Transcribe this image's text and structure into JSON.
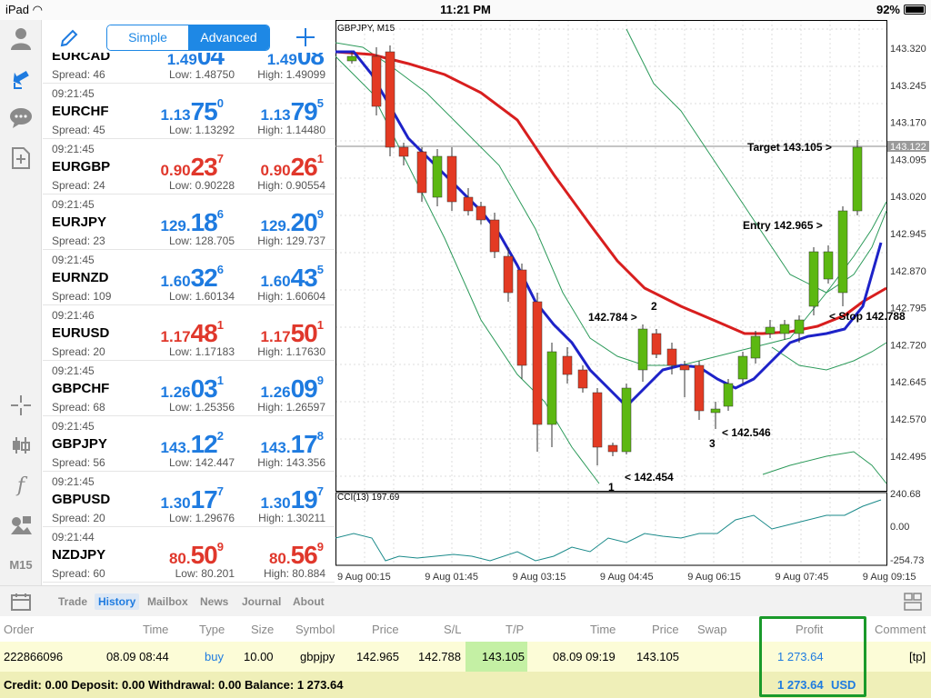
{
  "status": {
    "device": "iPad",
    "time": "11:21 PM",
    "battery": "92%"
  },
  "quotes_header": {
    "simple": "Simple",
    "advanced": "Advanced"
  },
  "toolbar": {
    "timeframe": "M15"
  },
  "quotes": [
    {
      "time": "",
      "symbol": "EURCAD",
      "spread": "Spread: 46",
      "low": "Low: 1.48750",
      "high": "High: 1.49099",
      "bid": {
        "a": "1.49",
        "b": "04",
        "c": ""
      },
      "ask": {
        "a": "1.49",
        "b": "08",
        "c": ""
      },
      "color": "blue"
    },
    {
      "time": "09:21:45",
      "symbol": "EURCHF",
      "spread": "Spread: 45",
      "low": "Low: 1.13292",
      "high": "High: 1.14480",
      "bid": {
        "a": "1.13",
        "b": "75",
        "c": "0"
      },
      "ask": {
        "a": "1.13",
        "b": "79",
        "c": "5"
      },
      "color": "blue"
    },
    {
      "time": "09:21:45",
      "symbol": "EURGBP",
      "spread": "Spread: 24",
      "low": "Low: 0.90228",
      "high": "High: 0.90554",
      "bid": {
        "a": "0.90",
        "b": "23",
        "c": "7"
      },
      "ask": {
        "a": "0.90",
        "b": "26",
        "c": "1"
      },
      "color": "red"
    },
    {
      "time": "09:21:45",
      "symbol": "EURJPY",
      "spread": "Spread: 23",
      "low": "Low: 128.705",
      "high": "High: 129.737",
      "bid": {
        "a": "129.",
        "b": "18",
        "c": "6"
      },
      "ask": {
        "a": "129.",
        "b": "20",
        "c": "9"
      },
      "color": "blue"
    },
    {
      "time": "09:21:45",
      "symbol": "EURNZD",
      "spread": "Spread: 109",
      "low": "Low: 1.60134",
      "high": "High: 1.60604",
      "bid": {
        "a": "1.60",
        "b": "32",
        "c": "6"
      },
      "ask": {
        "a": "1.60",
        "b": "43",
        "c": "5"
      },
      "color": "blue"
    },
    {
      "time": "09:21:46",
      "symbol": "EURUSD",
      "spread": "Spread: 20",
      "low": "Low: 1.17183",
      "high": "High: 1.17630",
      "bid": {
        "a": "1.17",
        "b": "48",
        "c": "1"
      },
      "ask": {
        "a": "1.17",
        "b": "50",
        "c": "1"
      },
      "color": "red"
    },
    {
      "time": "09:21:45",
      "symbol": "GBPCHF",
      "spread": "Spread: 68",
      "low": "Low: 1.25356",
      "high": "High: 1.26597",
      "bid": {
        "a": "1.26",
        "b": "03",
        "c": "1"
      },
      "ask": {
        "a": "1.26",
        "b": "09",
        "c": "9"
      },
      "color": "blue"
    },
    {
      "time": "09:21:45",
      "symbol": "GBPJPY",
      "spread": "Spread: 56",
      "low": "Low: 142.447",
      "high": "High: 143.356",
      "bid": {
        "a": "143.",
        "b": "12",
        "c": "2"
      },
      "ask": {
        "a": "143.",
        "b": "17",
        "c": "8"
      },
      "color": "blue"
    },
    {
      "time": "09:21:45",
      "symbol": "GBPUSD",
      "spread": "Spread: 20",
      "low": "Low: 1.29676",
      "high": "High: 1.30211",
      "bid": {
        "a": "1.30",
        "b": "17",
        "c": "7"
      },
      "ask": {
        "a": "1.30",
        "b": "19",
        "c": "7"
      },
      "color": "blue"
    },
    {
      "time": "09:21:44",
      "symbol": "NZDJPY",
      "spread": "Spread: 60",
      "low": "Low: 80.201",
      "high": "High: 80.884",
      "bid": {
        "a": "80.",
        "b": "50",
        "c": "9"
      },
      "ask": {
        "a": "80.",
        "b": "56",
        "c": "9"
      },
      "color": "red"
    }
  ],
  "chart": {
    "title": "GBPJPY, M15",
    "current_price": "143.122",
    "cci_label": "CCI(13) 197.69",
    "price_ticks": [
      "143.320",
      "143.245",
      "143.170",
      "143.095",
      "143.020",
      "142.945",
      "142.870",
      "142.795",
      "142.720",
      "142.645",
      "142.570",
      "142.495"
    ],
    "cci_ticks": [
      "240.68",
      "0.00",
      "-254.73"
    ],
    "time_ticks": [
      "9 Aug 00:15",
      "9 Aug 01:45",
      "9 Aug 03:15",
      "9 Aug 04:45",
      "9 Aug 06:15",
      "9 Aug 07:45",
      "9 Aug 09:15"
    ],
    "annotations": {
      "target": "Target 143.105 >",
      "entry": "Entry 142.965 >",
      "stop": "< Stop 142.788",
      "p2": "142.784 >",
      "p2n": "2",
      "p1": "< 142.454",
      "p1n": "1",
      "p3": "< 142.546",
      "p3n": "3"
    }
  },
  "tabs": [
    "Trade",
    "History",
    "Mailbox",
    "News",
    "Journal",
    "About"
  ],
  "active_tab": "History",
  "history": {
    "headers": [
      "Order",
      "Time",
      "Type",
      "Size",
      "Symbol",
      "Price",
      "S/L",
      "T/P",
      "Time",
      "Price",
      "Swap",
      "Profit",
      "Comment"
    ],
    "row": {
      "order": "222866096",
      "time": "08.09 08:44",
      "type": "buy",
      "size": "10.00",
      "symbol": "gbpjpy",
      "price": "142.965",
      "sl": "142.788",
      "tp": "143.105",
      "close_time": "08.09 09:19",
      "close_price": "143.105",
      "swap": "",
      "profit": "1 273.64",
      "comment": "[tp]"
    },
    "summary": "Credit: 0.00 Deposit: 0.00 Withdrawal: 0.00 Balance: 1 273.64",
    "summary_profit": "1 273.64",
    "currency": "USD"
  },
  "colors": {
    "accent": "#1e7be0",
    "bull": "#5cb811",
    "bear": "#e33a23",
    "ma_fast": "#1d22c8",
    "ma_slow": "#d81e1e",
    "band": "#2c9a5a",
    "highlight": "#1a9a2a"
  }
}
